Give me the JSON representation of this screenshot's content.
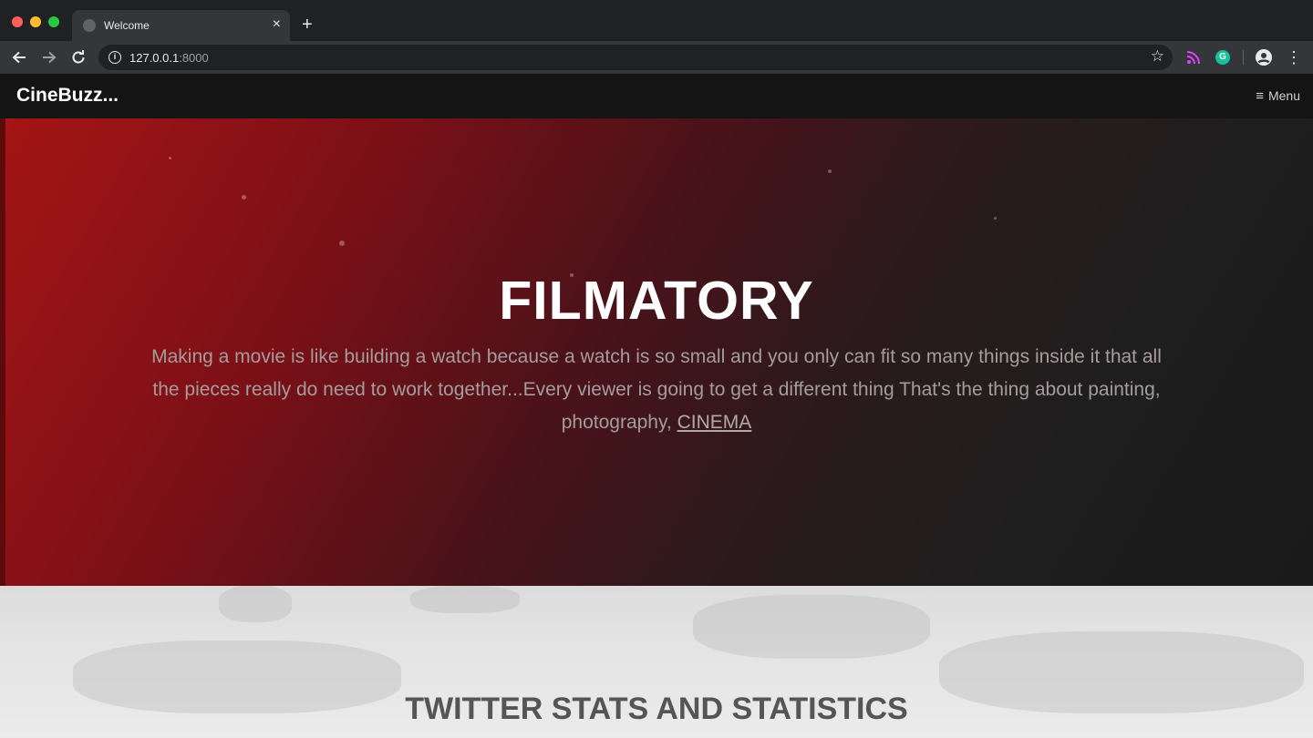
{
  "browser": {
    "tab_title": "Welcome",
    "url_host": "127.0.0.1",
    "url_port": ":8000"
  },
  "site": {
    "brand": "CineBuzz...",
    "menu_label": "Menu"
  },
  "hero": {
    "title": "FILMATORY",
    "quote": "Making a movie is like building a watch because a watch is so small and you only can fit so many things inside it that all the pieces really do need to work together...Every viewer is going to get a different thing That's the thing about painting, photography, ",
    "quote_link": "CINEMA"
  },
  "section": {
    "heading": "TWITTER STATS AND STATISTICS"
  }
}
